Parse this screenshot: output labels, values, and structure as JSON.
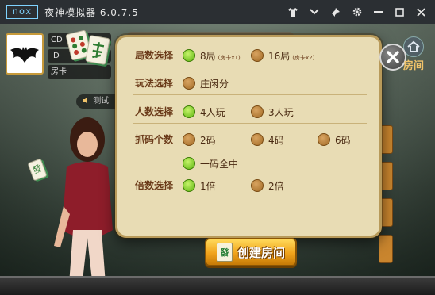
{
  "window": {
    "logo": "nox",
    "title": "夜神模拟器 6.0.7.5",
    "icons": [
      "shirt-icon",
      "chevron-down-icon",
      "pin-icon",
      "gear-icon",
      "minimize-icon",
      "maximize-icon",
      "close-icon"
    ]
  },
  "game": {
    "user_id_prefix": "CD",
    "user_id2_prefix": "ID",
    "room_card_prefix": "房卡",
    "notice_text": "测试",
    "side_tile_char": "發",
    "top_right_label": "房间"
  },
  "dialog": {
    "sections": {
      "rounds": {
        "label": "局数选择",
        "options": [
          {
            "text": "8局",
            "sub": "(房卡x1)",
            "selected": true
          },
          {
            "text": "16局",
            "sub": "(房卡x2)",
            "selected": false
          }
        ]
      },
      "mode": {
        "label": "玩法选择",
        "options": [
          {
            "text": "庄闲分",
            "selected": false
          }
        ]
      },
      "players": {
        "label": "人数选择",
        "options": [
          {
            "text": "4人玩",
            "selected": true
          },
          {
            "text": "3人玩",
            "selected": false
          }
        ]
      },
      "codes": {
        "label": "抓码个数",
        "options": [
          {
            "text": "2码",
            "selected": false
          },
          {
            "text": "4码",
            "selected": false
          },
          {
            "text": "6码",
            "selected": false
          },
          {
            "text": "一码全中",
            "selected": true
          }
        ]
      },
      "multiplier": {
        "label": "倍数选择",
        "options": [
          {
            "text": "1倍",
            "selected": true
          },
          {
            "text": "2倍",
            "selected": false
          }
        ]
      }
    },
    "create_button": "创建房间",
    "create_button_tile": "發"
  },
  "colors": {
    "dialog_bg": "#e8dcb4",
    "label": "#6b3b1a",
    "radio_on": "#5cb40f",
    "radio_off": "#a16a25",
    "button": "#f0a21a"
  }
}
